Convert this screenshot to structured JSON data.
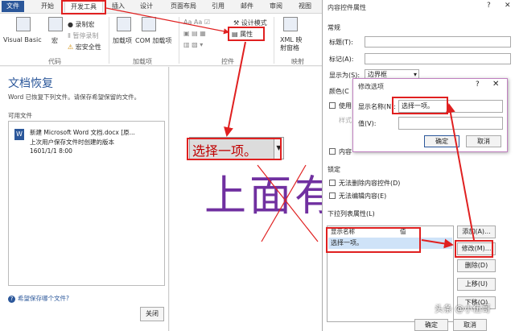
{
  "ribbon": {
    "tabs": [
      "文件",
      "开始",
      "开发工具",
      "插入",
      "设计",
      "页面布局",
      "引用",
      "邮件",
      "审阅",
      "视图"
    ],
    "items": {
      "visual_basic": "Visual Basic",
      "macro": "宏",
      "record_macro": "录制宏",
      "pause_record": "暂停录制",
      "macro_security": "宏安全性",
      "addins": "加载项",
      "com_addins": "COM 加载项",
      "design_mode": "设计模式",
      "properties": "属性",
      "xml_mapping_line1": "XML 映",
      "xml_mapping_line2": "射窗格"
    },
    "groups": {
      "code": "代码",
      "addins": "加载项",
      "controls": "控件",
      "mapping": "映射"
    }
  },
  "recovery": {
    "title": "文档恢复",
    "description": "Word 已恢复下列文件。请保存希望保留的文件。",
    "available_label": "可用文件",
    "files": [
      {
        "name": "新建 Microsoft Word 文档.docx  [原...",
        "detail": "上次用户保存文件时创建的版本",
        "date": "1601/1/1 8:00"
      }
    ],
    "help_link": "希望保存哪个文件?",
    "close_button": "关闭"
  },
  "canvas": {
    "control_text": "选择一项。",
    "big_text": "上面有"
  },
  "properties_dialog": {
    "title": "内容控件属性",
    "help": "?",
    "close": "✕",
    "general_section": "常规",
    "title_label": "标题(T):",
    "tag_label": "标记(A):",
    "show_as_label": "显示为(S):",
    "show_as_value": "边界框",
    "color_label": "颜色(C",
    "use_style_label": "使用",
    "style_label": "样式",
    "content_label": "内容",
    "lock_section": "锁定",
    "lock_delete": "无法删除内容控件(D)",
    "lock_edit": "无法编辑内容(E)",
    "dropdown_section": "下拉列表属性(L)",
    "grid_col_display": "显示名称",
    "grid_col_value": "值",
    "grid_row_display": "选择一项。",
    "buttons": {
      "add": "添加(A)...",
      "modify": "修改(M)...",
      "delete": "删除(D)",
      "move_up": "上移(U)",
      "move_down": "下移(O)"
    },
    "ok": "确定",
    "cancel": "取消"
  },
  "modify_dialog": {
    "title": "修改选项",
    "help": "?",
    "close": "✕",
    "display_name_label": "显示名称(N):",
    "display_name_value": "选择一项。",
    "value_label": "值(V):",
    "value_value": "",
    "ok": "确定",
    "cancel": "取消"
  },
  "watermark": "头条 @小伍哥",
  "colors": {
    "accent": "#2b579a",
    "annotation_red": "#e02020",
    "big_text": "#7030a0",
    "control_text": "#c00000"
  }
}
